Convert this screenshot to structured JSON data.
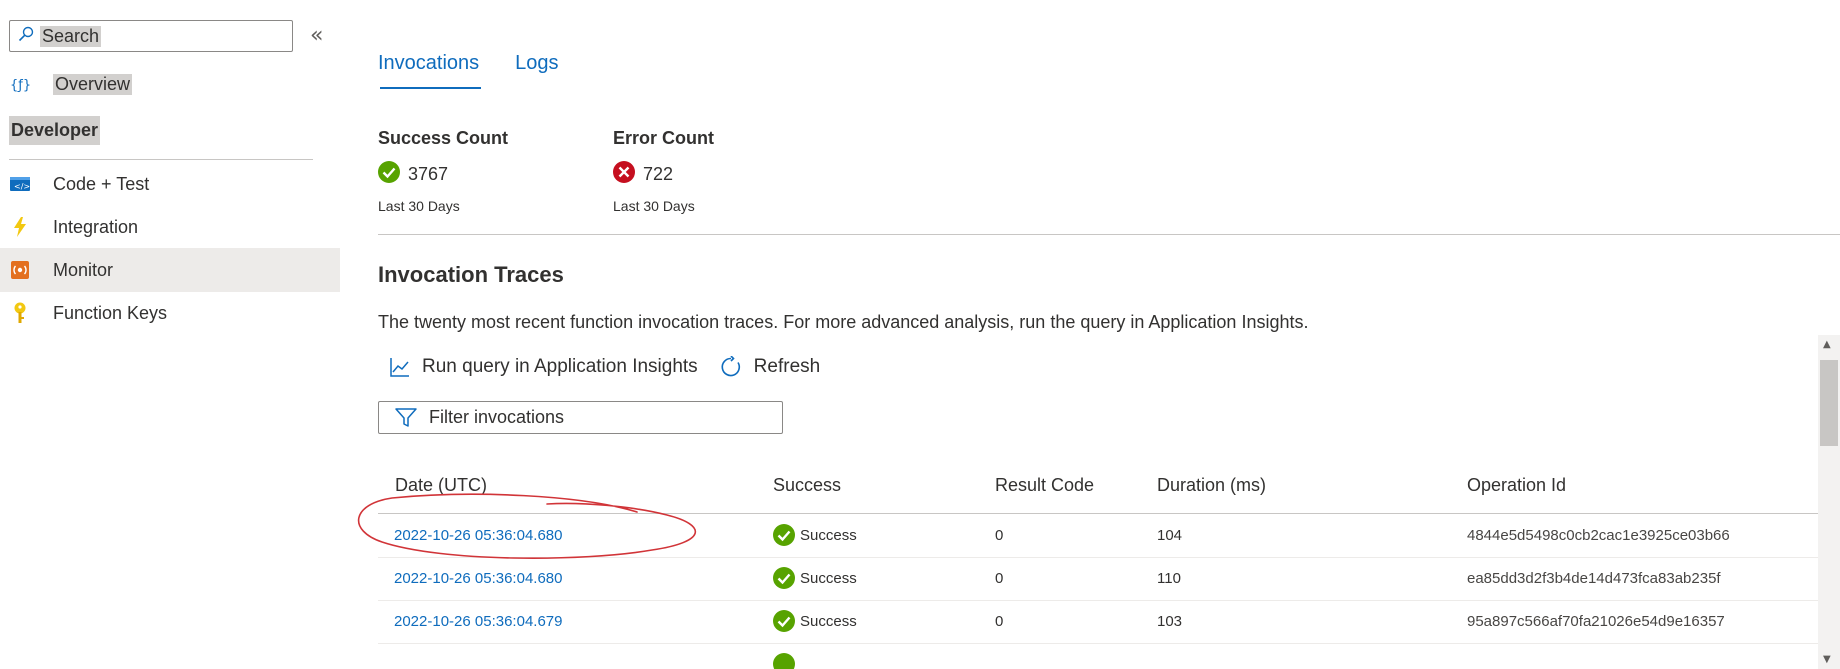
{
  "sidebar": {
    "search": {
      "value": "Search"
    },
    "collapse_glyph": "«",
    "overview_label": "Overview",
    "section_header": "Developer",
    "items": [
      {
        "label": "Code + Test",
        "icon": "code-icon"
      },
      {
        "label": "Integration",
        "icon": "lightning-icon"
      },
      {
        "label": "Monitor",
        "icon": "monitor-icon",
        "selected": true
      },
      {
        "label": "Function Keys",
        "icon": "key-icon"
      }
    ]
  },
  "tabs": [
    {
      "label": "Invocations",
      "active": true
    },
    {
      "label": "Logs",
      "active": false
    }
  ],
  "stats": {
    "success": {
      "title": "Success Count",
      "value": "3767",
      "sub": "Last 30 Days"
    },
    "error": {
      "title": "Error Count",
      "value": "722",
      "sub": "Last 30 Days"
    }
  },
  "traces": {
    "title": "Invocation Traces",
    "description": "The twenty most recent function invocation traces. For more advanced analysis, run the query in Application Insights.",
    "run_query_label": "Run query in Application Insights",
    "refresh_label": "Refresh",
    "filter_placeholder": "Filter invocations"
  },
  "table": {
    "headers": {
      "date": "Date (UTC)",
      "success": "Success",
      "result_code": "Result Code",
      "duration": "Duration (ms)",
      "operation_id": "Operation Id"
    },
    "rows": [
      {
        "date": "2022-10-26 05:36:04.680",
        "status": "Success",
        "result_code": "0",
        "duration": "104",
        "operation_id": "4844e5d5498c0cb2cac1e3925ce03b66"
      },
      {
        "date": "2022-10-26 05:36:04.680",
        "status": "Success",
        "result_code": "0",
        "duration": "110",
        "operation_id": "ea85dd3d2f3b4de14d473fca83ab235f"
      },
      {
        "date": "2022-10-26 05:36:04.679",
        "status": "Success",
        "result_code": "0",
        "duration": "103",
        "operation_id": "95a897c566af70fa21026e54d9e16357"
      }
    ]
  },
  "colors": {
    "accent": "#0f6cbd",
    "success": "#57a300",
    "error": "#c50f1f",
    "annotation": "#d13438"
  }
}
